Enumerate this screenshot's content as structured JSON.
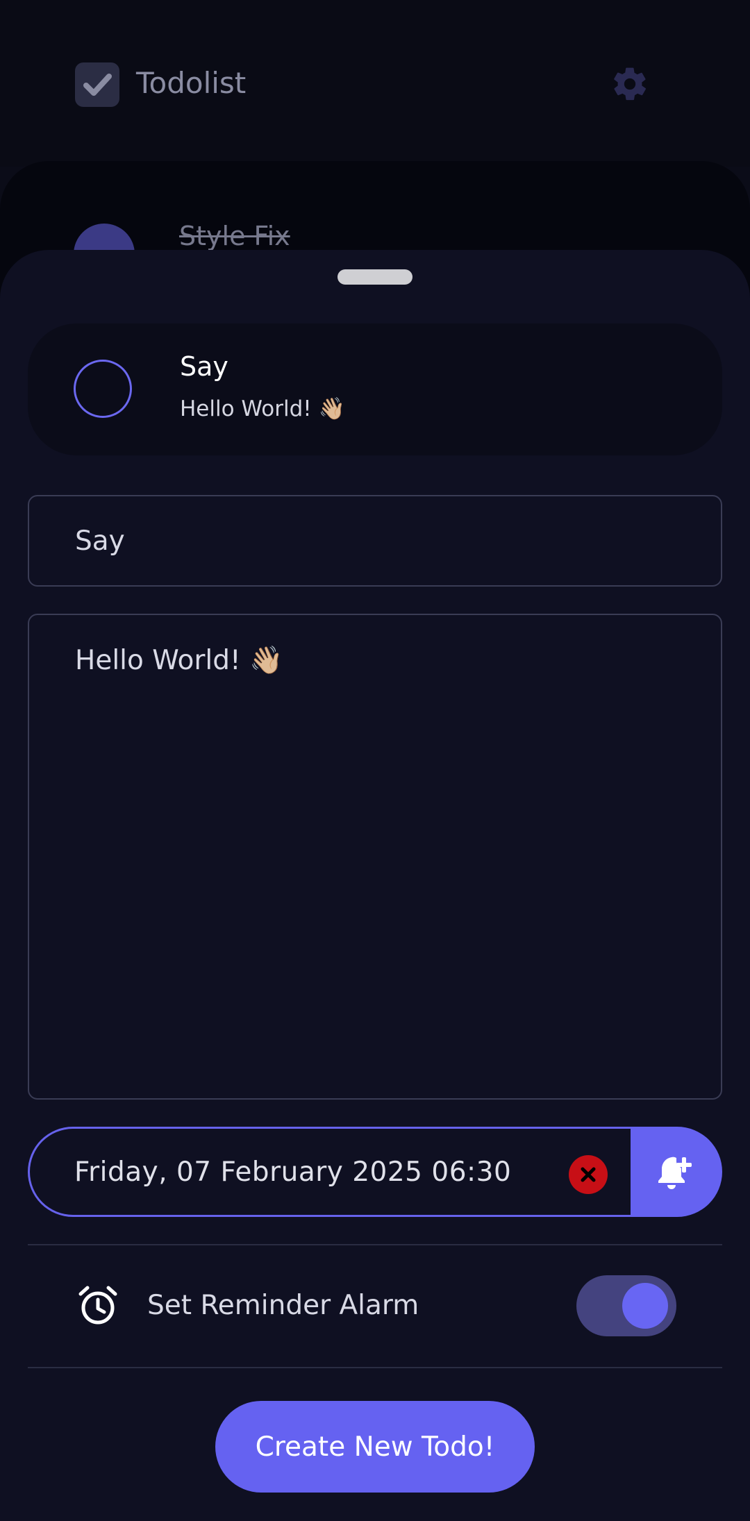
{
  "app": {
    "title": "Todolist"
  },
  "background_list": {
    "items": [
      {
        "title": "Style Fix",
        "completed": true
      }
    ]
  },
  "preview": {
    "title": "Say",
    "description": "Hello World! 👋🏼"
  },
  "form": {
    "title_value": "Say",
    "description_value": "Hello World! 👋🏼",
    "date_value": "Friday, 07 February 2025 06:30",
    "alarm_label": "Set Reminder Alarm",
    "alarm_enabled": true,
    "submit_label": "Create New Todo!"
  },
  "icons": {
    "logo": "checkbox-icon",
    "settings": "gear-icon",
    "clear_date": "close-icon",
    "add_reminder": "bell-plus-icon",
    "alarm": "alarm-clock-icon"
  },
  "colors": {
    "accent": "#6562f1",
    "danger": "#c70f16",
    "sheet": "#0f1022",
    "background": "#0b0c18"
  }
}
